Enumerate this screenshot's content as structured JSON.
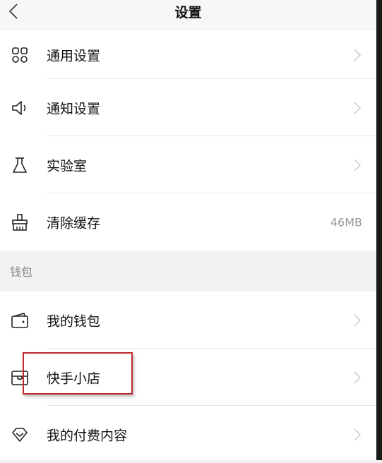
{
  "header": {
    "title": "设置",
    "back_icon": "chevron-left-icon"
  },
  "general": {
    "items": [
      {
        "label": "通用设置",
        "icon": "grid-icon"
      },
      {
        "label": "通知设置",
        "icon": "speaker-icon"
      },
      {
        "label": "实验室",
        "icon": "flask-icon"
      },
      {
        "label": "清除缓存",
        "icon": "broom-icon",
        "value": "46MB"
      }
    ]
  },
  "wallet_section": {
    "title": "钱包"
  },
  "wallet": {
    "items": [
      {
        "label": "我的钱包",
        "icon": "wallet-icon"
      },
      {
        "label": "快手小店",
        "icon": "store-icon"
      },
      {
        "label": "我的付费内容",
        "icon": "diamond-icon"
      }
    ]
  },
  "colors": {
    "highlight_border": "#c0282d",
    "chevron": "#c8c8c8"
  }
}
